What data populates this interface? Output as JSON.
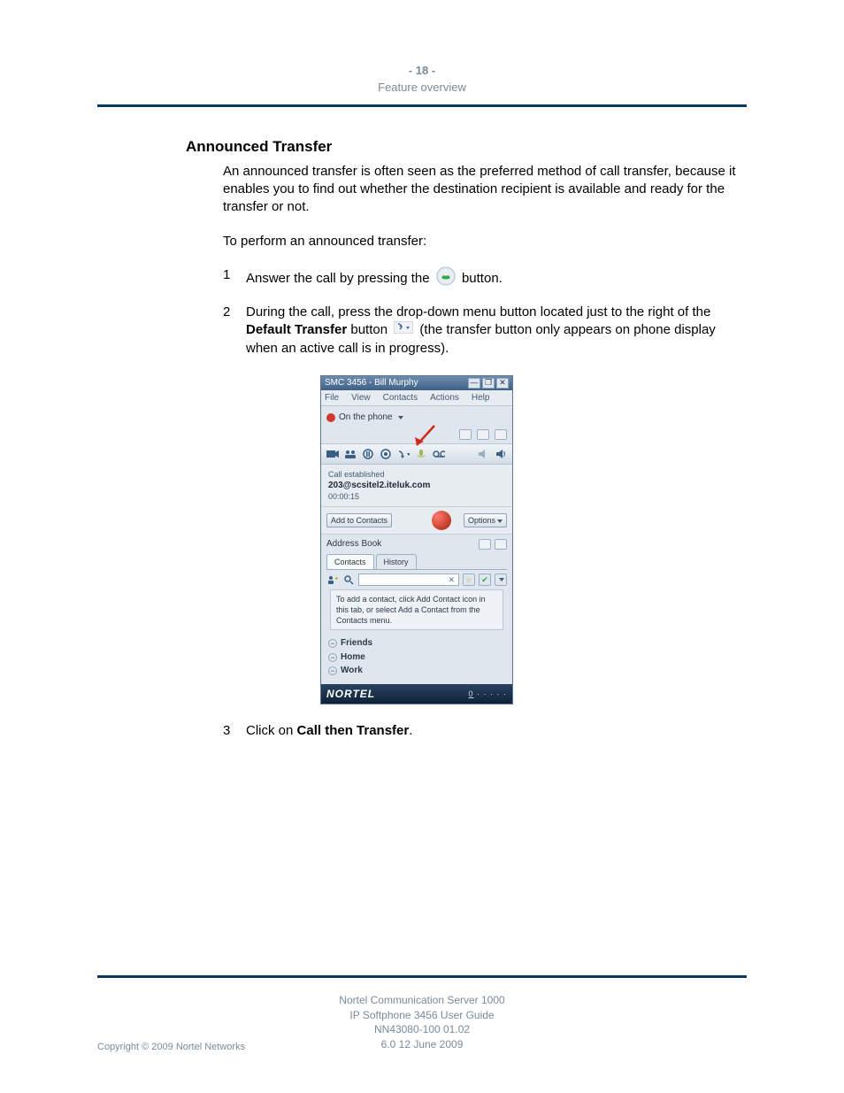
{
  "header": {
    "page_number": "- 18 -",
    "section": "Feature overview"
  },
  "heading": "Announced Transfer",
  "intro": "An announced transfer is often seen as the preferred method of call transfer, because it enables you to find out whether the destination recipient is available and ready for the transfer or not.",
  "lead": "To perform an announced transfer:",
  "steps": {
    "s1": {
      "num": "1",
      "a": "Answer the call by pressing the ",
      "b": " button."
    },
    "s2": {
      "num": "2",
      "a": "During the call, press the drop-down menu button located just to the right of the ",
      "bold": "Default Transfer",
      "b": " button ",
      "c": " (the transfer button only appears on phone display when an active call is in progress)."
    },
    "s3": {
      "num": "3",
      "a": "Click on ",
      "bold": "Call then Transfer",
      "b": "."
    }
  },
  "softphone": {
    "title": "SMC 3456 - Bill Murphy",
    "menu": {
      "file": "File",
      "view": "View",
      "contacts": "Contacts",
      "actions": "Actions",
      "help": "Help"
    },
    "status": "On the phone",
    "call": {
      "state": "Call established",
      "address": "203@scsitel2.iteluk.com",
      "timer": "00:00:15"
    },
    "add_to_contacts": "Add to Contacts",
    "options": "Options",
    "address_book": "Address Book",
    "tabs": {
      "contacts": "Contacts",
      "history": "History"
    },
    "hint": "To add a contact, click Add Contact icon in this tab, or select Add a Contact from the Contacts menu.",
    "groups": {
      "friends": "Friends",
      "home": "Home",
      "work": "Work"
    },
    "brand": "NORTEL",
    "footer_count": "0"
  },
  "footer": {
    "l1": "Nortel Communication Server 1000",
    "l2": "IP Softphone 3456 User Guide",
    "l3": "NN43080-100   01.02",
    "l4": "6.0   12 June 2009"
  },
  "copyright": "Copyright © 2009 Nortel Networks"
}
